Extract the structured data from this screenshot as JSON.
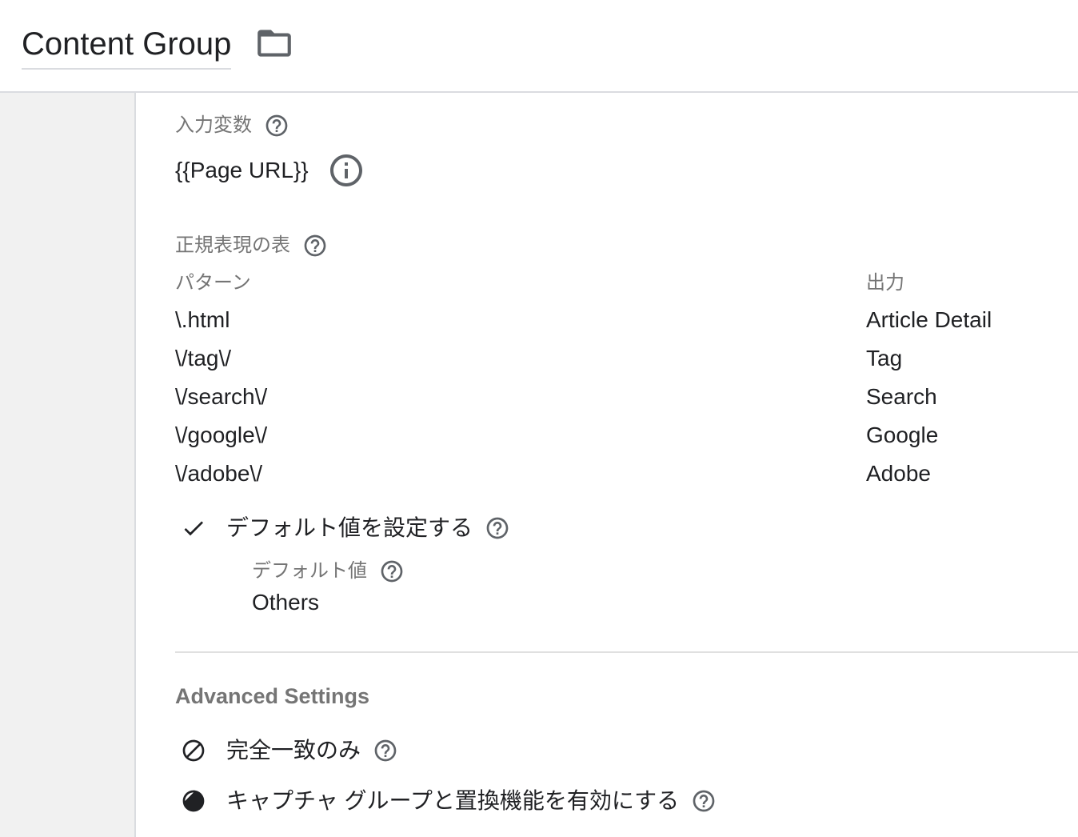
{
  "header": {
    "title": "Content Group"
  },
  "input_variable": {
    "label": "入力変数",
    "value": "{{Page URL}}"
  },
  "regex_table": {
    "label": "正規表現の表",
    "columns": {
      "pattern": "パターン",
      "output": "出力"
    },
    "rows": [
      {
        "pattern": "\\.html",
        "output": "Article Detail"
      },
      {
        "pattern": "\\/tag\\/",
        "output": "Tag"
      },
      {
        "pattern": "\\/search\\/",
        "output": "Search"
      },
      {
        "pattern": "\\/google\\/",
        "output": "Google"
      },
      {
        "pattern": "\\/adobe\\/",
        "output": "Adobe"
      }
    ]
  },
  "default_value": {
    "checkbox_label": "デフォルト値を設定する",
    "checked": true,
    "label": "デフォルト値",
    "value": "Others"
  },
  "advanced_settings": {
    "heading": "Advanced Settings",
    "options": [
      {
        "label": "完全一致のみ",
        "enabled": false
      },
      {
        "label": "キャプチャ グループと置換機能を有効にする",
        "enabled": false
      }
    ]
  },
  "icons": {
    "folder": "folder-open-icon",
    "help": "help-outline-icon",
    "info": "info-outline-icon",
    "check": "check-icon",
    "block": "block-icon"
  },
  "colors": {
    "text": "#202124",
    "label": "#757575",
    "icon": "#5f6368",
    "sidebar": "#f1f1f1",
    "border": "#dadce0",
    "divider": "#e0e0e0"
  }
}
